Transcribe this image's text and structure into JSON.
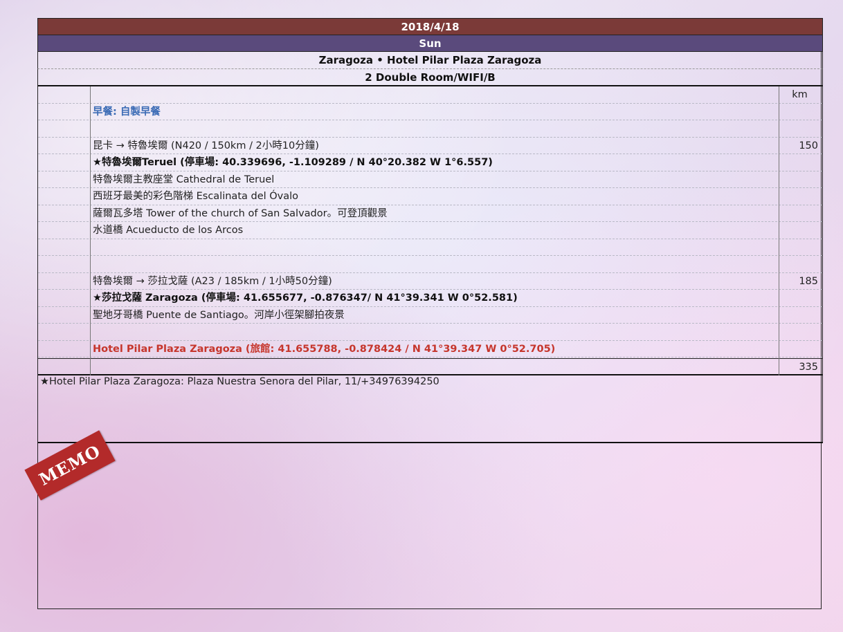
{
  "header": {
    "date": "2018/4/18",
    "day": "Sun",
    "hotel": "Zaragoza • Hotel Pilar Plaza Zaragoza",
    "room": "2 Double Room/WIFI/B"
  },
  "table": {
    "km_header": "km",
    "rows": [
      {
        "text": "早餐: 自製早餐",
        "km": "",
        "style": "blue"
      },
      {
        "text": "",
        "km": "",
        "style": ""
      },
      {
        "text": "昆卡 → 特魯埃爾 (N420 / 150km / 2小時10分鐘)",
        "km": "150",
        "style": ""
      },
      {
        "text": "★特魯埃爾Teruel (停車場: 40.339696, -1.109289 / N 40°20.382 W 1°6.557)",
        "km": "",
        "style": "bold"
      },
      {
        "text": "特魯埃爾主教座堂 Cathedral de Teruel",
        "km": "",
        "style": ""
      },
      {
        "text": "西班牙最美的彩色階梯 Escalinata del Óvalo",
        "km": "",
        "style": ""
      },
      {
        "text": "薩爾瓦多塔 Tower of the church of San Salvador。可登頂觀景",
        "km": "",
        "style": ""
      },
      {
        "text": "水道橋 Acueducto de los Arcos",
        "km": "",
        "style": ""
      },
      {
        "text": "",
        "km": "",
        "style": ""
      },
      {
        "text": "",
        "km": "",
        "style": ""
      },
      {
        "text": "特魯埃爾 → 莎拉戈薩 (A23 / 185km / 1小時50分鐘)",
        "km": "185",
        "style": ""
      },
      {
        "text": "★莎拉戈薩 Zaragoza (停車場: 41.655677, -0.876347/ N 41°39.341 W 0°52.581)",
        "km": "",
        "style": "bold"
      },
      {
        "text": "聖地牙哥橋 Puente de Santiago。河岸小徑架腳拍夜景",
        "km": "",
        "style": ""
      },
      {
        "text": "",
        "km": "",
        "style": ""
      },
      {
        "text": "Hotel Pilar Plaza Zaragoza (旅館: 41.655788, -0.878424 / N 41°39.347 W 0°52.705)",
        "km": "",
        "style": "red"
      }
    ],
    "total_km": "335"
  },
  "note": "★Hotel Pilar Plaza Zaragoza: Plaza Nuestra Senora del Pilar, 11/+34976394250",
  "memo_label": "MEMO"
}
